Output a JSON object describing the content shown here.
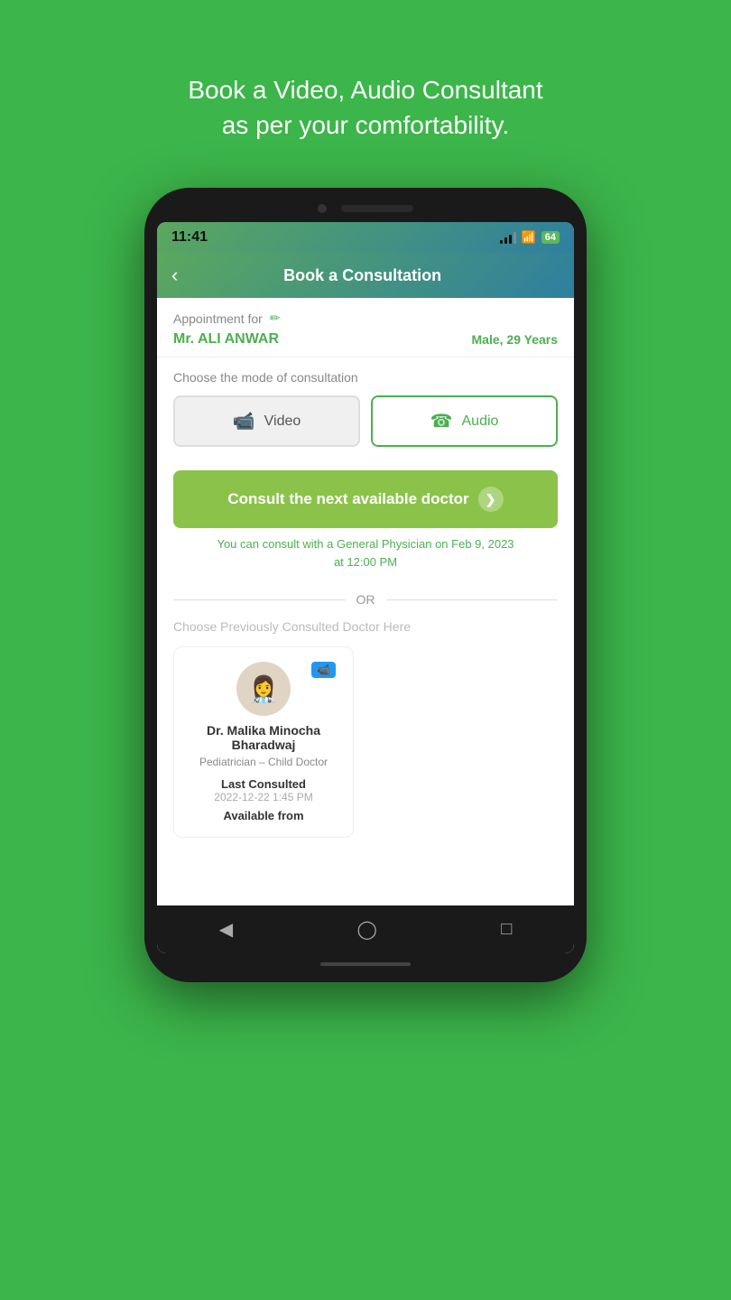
{
  "page": {
    "background_color": "#3cb54a",
    "headline": "Book a Video, Audio Consultant\nas per your comfortability."
  },
  "status_bar": {
    "time": "11:41",
    "battery": "64",
    "signal_level": 3,
    "wifi": true
  },
  "header": {
    "title": "Book a Consultation",
    "back_label": "‹"
  },
  "appointment": {
    "for_label": "Appointment for",
    "patient_name": "Mr. ALI ANWAR",
    "patient_info": "Male, 29 Years"
  },
  "consultation_mode": {
    "label": "Choose the mode of consultation",
    "video_label": "Video",
    "audio_label": "Audio"
  },
  "cta": {
    "button_label": "Consult the next available doctor",
    "availability_text": "You can consult with a General Physician on Feb 9, 2023\nat 12:00 PM"
  },
  "divider": {
    "or_text": "OR"
  },
  "prev_section": {
    "label": "Choose Previously Consulted Doctor Here",
    "doctor_name": "Dr. Malika Minocha\nBharadwaj",
    "doctor_specialty": "Pediatrician – Child Doctor",
    "last_consulted_label": "Last Consulted",
    "last_consulted_date": "2022-12-22 1:45 PM",
    "available_from_label": "Available from"
  }
}
